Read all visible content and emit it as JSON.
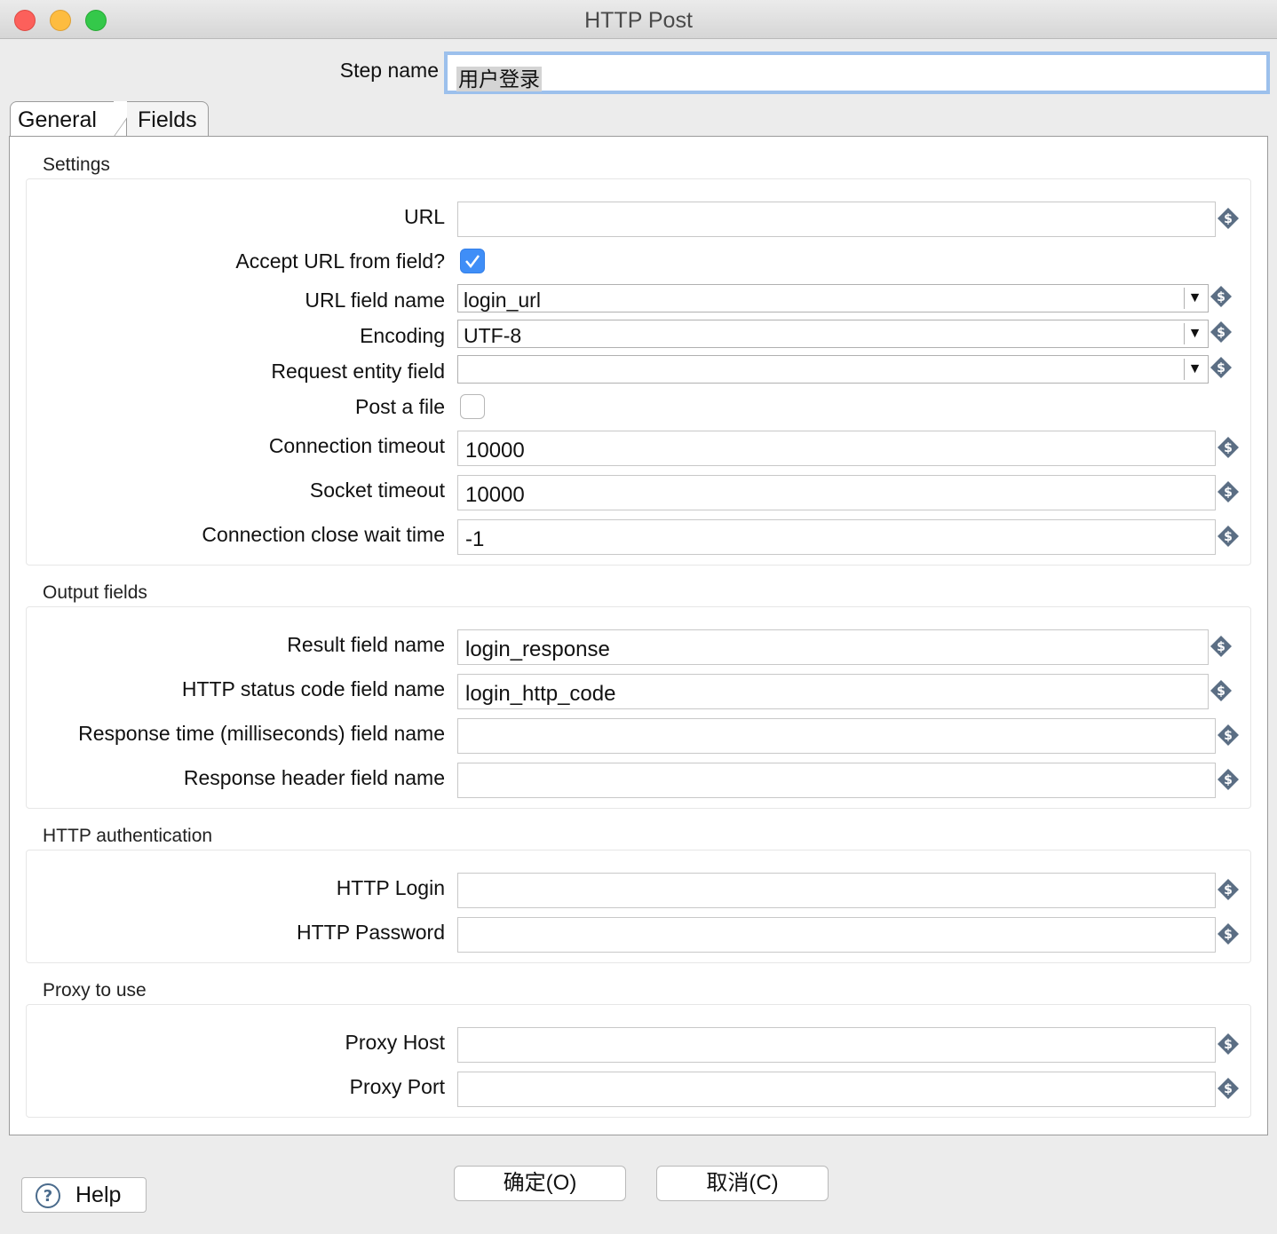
{
  "window": {
    "title": "HTTP Post"
  },
  "step": {
    "label": "Step name",
    "value": "用户登录"
  },
  "tabs": [
    {
      "label": "General",
      "active": true
    },
    {
      "label": "Fields",
      "active": false
    }
  ],
  "settings": {
    "title": "Settings",
    "url": {
      "label": "URL",
      "value": ""
    },
    "accept_url": {
      "label": "Accept URL from field?",
      "checked": true
    },
    "url_field": {
      "label": "URL field name",
      "value": "login_url"
    },
    "encoding": {
      "label": "Encoding",
      "value": "UTF-8"
    },
    "request_entity": {
      "label": "Request entity field",
      "value": ""
    },
    "post_file": {
      "label": "Post a file",
      "checked": false
    },
    "conn_timeout": {
      "label": "Connection timeout",
      "value": "10000"
    },
    "socket_timeout": {
      "label": "Socket timeout",
      "value": "10000"
    },
    "close_wait": {
      "label": "Connection close wait time",
      "value": "-1"
    }
  },
  "output": {
    "title": "Output fields",
    "result": {
      "label": "Result field name",
      "value": "login_response"
    },
    "status": {
      "label": "HTTP status code field name",
      "value": "login_http_code"
    },
    "resp_time": {
      "label": "Response time (milliseconds) field name",
      "value": ""
    },
    "resp_header": {
      "label": "Response header field name",
      "value": ""
    }
  },
  "auth": {
    "title": "HTTP authentication",
    "login": {
      "label": "HTTP Login",
      "value": ""
    },
    "password": {
      "label": "HTTP Password",
      "value": ""
    }
  },
  "proxy": {
    "title": "Proxy to use",
    "host": {
      "label": "Proxy Host",
      "value": ""
    },
    "port": {
      "label": "Proxy Port",
      "value": ""
    }
  },
  "buttons": {
    "ok": "确定(O)",
    "cancel": "取消(C)",
    "help": "Help"
  },
  "icons": {
    "variable": "variable-dollar-icon",
    "help": "question-circle-icon",
    "dropdown": "dropdown-arrow-icon",
    "check": "checkmark-icon"
  }
}
